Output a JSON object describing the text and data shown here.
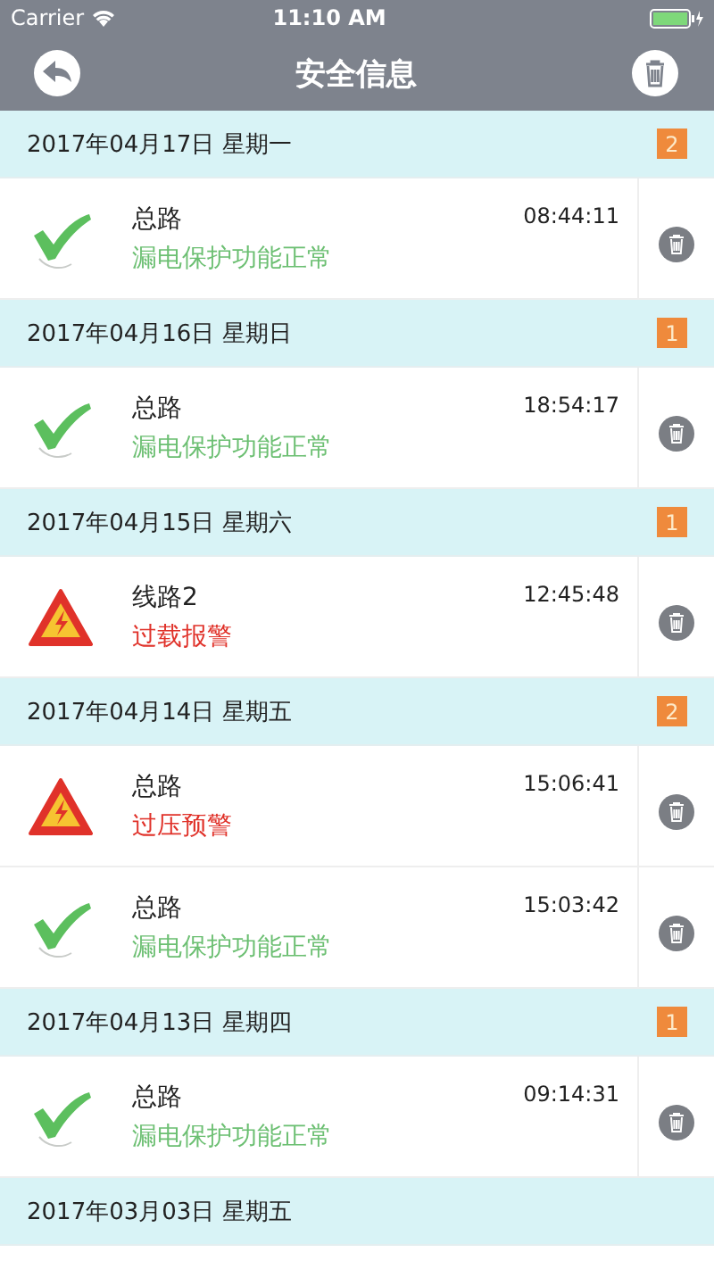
{
  "status_bar": {
    "carrier": "Carrier",
    "time": "11:10 AM"
  },
  "nav": {
    "title": "安全信息"
  },
  "groups": [
    {
      "date": "2017年04月17日 星期一",
      "count": "2",
      "records": [
        {
          "kind": "normal",
          "circuit": "总路",
          "time": "08:44:11",
          "message": "漏电保护功能正常"
        }
      ]
    },
    {
      "date": "2017年04月16日 星期日",
      "count": "1",
      "records": [
        {
          "kind": "normal",
          "circuit": "总路",
          "time": "18:54:17",
          "message": "漏电保护功能正常"
        }
      ]
    },
    {
      "date": "2017年04月15日 星期六",
      "count": "1",
      "records": [
        {
          "kind": "alarm",
          "circuit": "线路2",
          "time": "12:45:48",
          "message": "过载报警"
        }
      ]
    },
    {
      "date": "2017年04月14日 星期五",
      "count": "2",
      "records": [
        {
          "kind": "alarm",
          "circuit": "总路",
          "time": "15:06:41",
          "message": "过压预警"
        },
        {
          "kind": "normal",
          "circuit": "总路",
          "time": "15:03:42",
          "message": "漏电保护功能正常"
        }
      ]
    },
    {
      "date": "2017年04月13日 星期四",
      "count": "1",
      "records": [
        {
          "kind": "normal",
          "circuit": "总路",
          "time": "09:14:31",
          "message": "漏电保护功能正常"
        }
      ]
    },
    {
      "date": "2017年03月03日 星期五"
    }
  ]
}
